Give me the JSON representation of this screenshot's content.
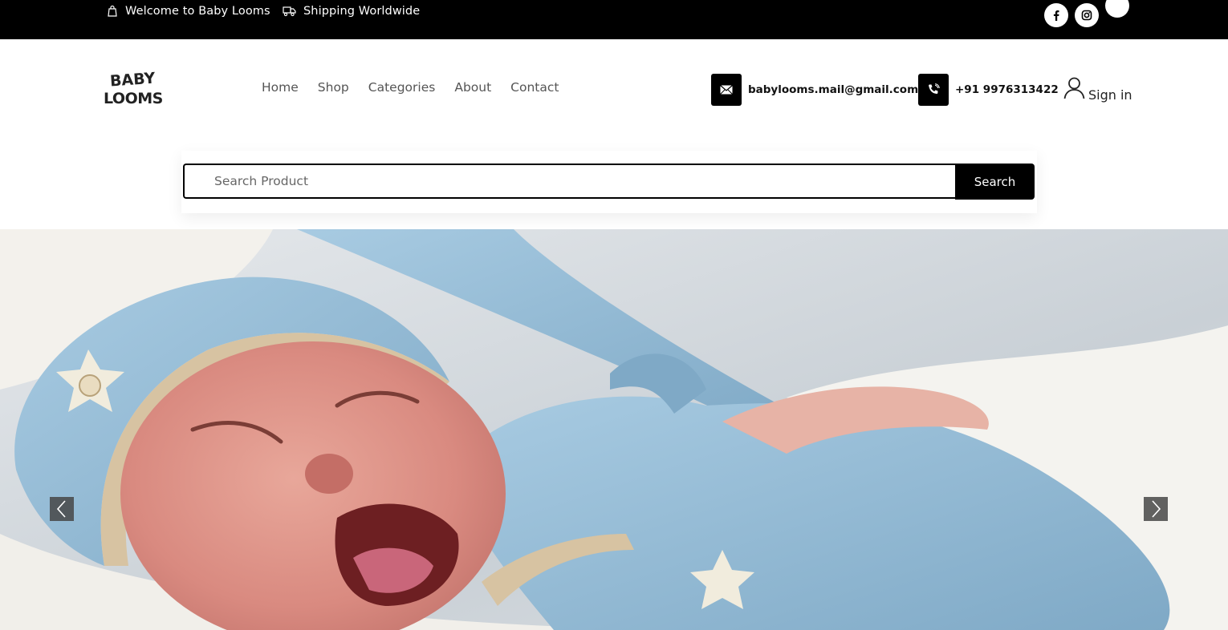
{
  "topbar": {
    "welcome": "Welcome to Baby Looms",
    "shipping": "Shipping Worldwide",
    "social": [
      {
        "icon": "facebook-icon"
      },
      {
        "icon": "instagram-icon"
      },
      {
        "icon": "social-icon"
      }
    ]
  },
  "header": {
    "logo": {
      "line1": "BABY",
      "line2": "LOOMS"
    },
    "nav": [
      "Home",
      "Shop",
      "Categories",
      "About",
      "Contact"
    ],
    "email": "babylooms.mail@gmail.com",
    "phone": "+91 9976313422",
    "signin": "Sign in"
  },
  "search": {
    "placeholder": "Search Product",
    "button": "Search"
  },
  "hero": {
    "image_icon": "crying-baby-photo",
    "prev_icon": "chevron-left-icon",
    "next_icon": "chevron-right-icon"
  },
  "colors": {
    "topbar": "#000000",
    "accent": "#000000",
    "nav_text": "#555555",
    "knit_blue": "#8fbad6"
  }
}
